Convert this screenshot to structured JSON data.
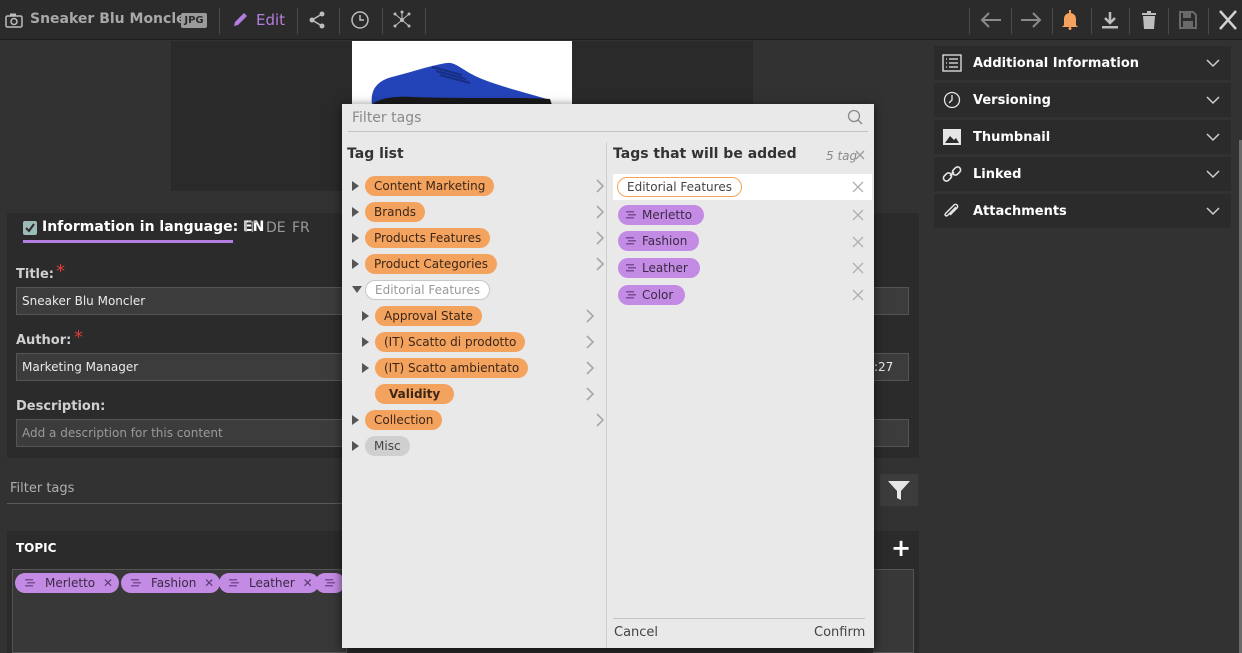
{
  "topbar": {
    "title": "Sneaker Blu Moncler",
    "badge": "JPG",
    "edit_label": "Edit",
    "icons": [
      "camera-icon",
      "pencil-icon",
      "share-icon",
      "history-icon",
      "network-icon",
      "arrow-left-icon",
      "arrow-right-icon",
      "bell-icon",
      "download-icon",
      "trash-icon",
      "save-icon",
      "close-icon"
    ]
  },
  "info": {
    "header": "Information in language: EN",
    "languages": [
      "IT",
      "DE",
      "FR"
    ],
    "title_label": "Title:",
    "title_value": "Sneaker Blu Moncler",
    "author_label": "Author:",
    "author_value": "Marketing Manager",
    "author_right_fragment": ":27",
    "description_label": "Description:",
    "description_placeholder": "Add a description for this content"
  },
  "filter": {
    "placeholder": "Filter tags"
  },
  "topic": {
    "label": "TOPIC",
    "chips": [
      "Merletto",
      "Fashion",
      "Leather"
    ]
  },
  "accordion": [
    {
      "label": "Additional Information",
      "icon": "list-icon"
    },
    {
      "label": "Versioning",
      "icon": "clock-icon"
    },
    {
      "label": "Thumbnail",
      "icon": "image-icon"
    },
    {
      "label": "Linked",
      "icon": "link-icon"
    },
    {
      "label": "Attachments",
      "icon": "paperclip-icon"
    }
  ],
  "modal": {
    "search_placeholder": "Filter tags",
    "tag_list_title": "Tag list",
    "added_title": "Tags that will be added",
    "count": "5 tag",
    "tree": [
      {
        "label": "Content Marketing",
        "style": "orange",
        "level": 0,
        "arrow": "right",
        "nav": true
      },
      {
        "label": "Brands",
        "style": "orange",
        "level": 0,
        "arrow": "right",
        "nav": true
      },
      {
        "label": "Products Features",
        "style": "orange",
        "level": 0,
        "arrow": "right",
        "nav": true
      },
      {
        "label": "Product Categories",
        "style": "orange",
        "level": 0,
        "arrow": "right",
        "nav": true
      },
      {
        "label": "Editorial Features",
        "style": "outline",
        "level": 0,
        "arrow": "down",
        "nav": false
      },
      {
        "label": "Approval State",
        "style": "orange",
        "level": 1,
        "arrow": "right",
        "nav": true
      },
      {
        "label": "(IT) Scatto di prodotto",
        "style": "orange",
        "level": 1,
        "arrow": "right",
        "nav": true
      },
      {
        "label": "(IT) Scatto ambientato",
        "style": "orange",
        "level": 1,
        "arrow": "right",
        "nav": true
      },
      {
        "label": "Validity",
        "style": "orange-bold",
        "level": 1,
        "arrow": "none",
        "nav": true
      },
      {
        "label": "Collection",
        "style": "orange",
        "level": 0,
        "arrow": "right",
        "nav": true
      },
      {
        "label": "Misc",
        "style": "grey",
        "level": 0,
        "arrow": "right",
        "nav": false
      }
    ],
    "selected": [
      {
        "label": "Editorial Features",
        "kind": "category"
      },
      {
        "label": "Merletto",
        "kind": "tag"
      },
      {
        "label": "Fashion",
        "kind": "tag"
      },
      {
        "label": "Leather",
        "kind": "tag"
      },
      {
        "label": "Color",
        "kind": "tag"
      }
    ],
    "cancel_label": "Cancel",
    "confirm_label": "Confirm"
  }
}
